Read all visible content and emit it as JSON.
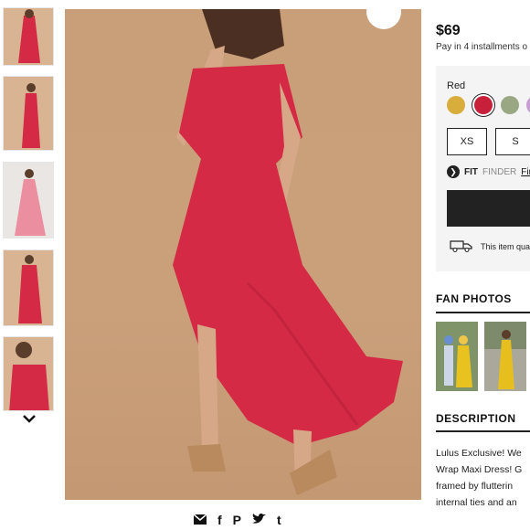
{
  "product": {
    "price": "$69",
    "installments": "Pay in 4 installments o",
    "color_label": "Red",
    "swatches": [
      {
        "name": "mustard",
        "color": "#d9ad3c"
      },
      {
        "name": "red",
        "color": "#c8203a",
        "selected": true
      },
      {
        "name": "sage",
        "color": "#9aa783"
      },
      {
        "name": "lilac",
        "color": "#c79bd3"
      }
    ],
    "sizes": [
      "XS",
      "S"
    ],
    "fit_finder": {
      "fit": "FIT",
      "finder": "FINDER",
      "link": "Fin"
    },
    "shipping_text": "This item qua"
  },
  "sections": {
    "fan_photos_title": "FAN PHOTOS",
    "description_title": "DESCRIPTION",
    "description_lines": [
      "Lulus Exclusive! We",
      "Wrap Maxi Dress! G",
      "framed by flutterin",
      "internal ties and an"
    ]
  },
  "share_icons": [
    "email-icon",
    "facebook-icon",
    "pinterest-icon",
    "twitter-icon",
    "tumblr-icon"
  ],
  "colors": {
    "dress_red": "#d42a45",
    "backdrop": "#c99f79",
    "dark": "#222222"
  }
}
